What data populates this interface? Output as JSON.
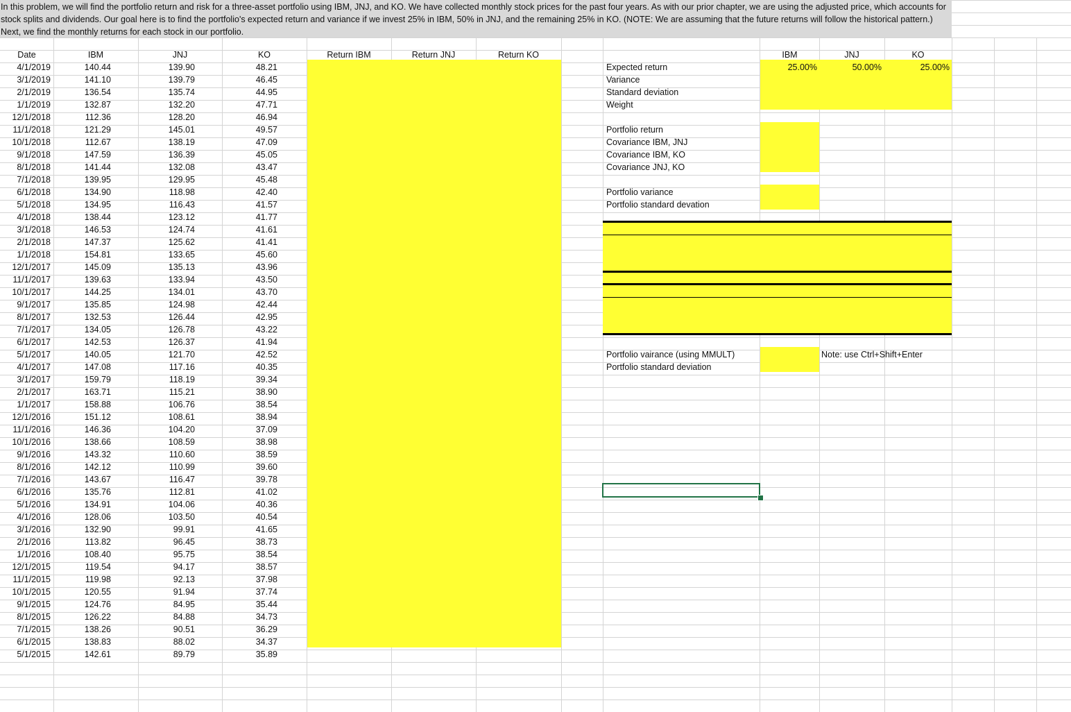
{
  "intro": {
    "text": "In this problem, we will find the portfolio return and risk for a three-asset portfolio using IBM, JNJ, and KO. We have collected monthly stock prices for the past four years. As with our prior chapter, we are using the adjusted price, which accounts for stock splits and dividends. Our goal here is to find the portfolio's expected return and variance if we invest 25% in IBM, 50% in JNJ, and the remaining 25% in KO. (NOTE: We are assuming that the future returns will follow the historical pattern.) Next, we find the monthly returns for each stock in our portfolio."
  },
  "headers": {
    "date": "Date",
    "ibm": "IBM",
    "jnj": "JNJ",
    "ko": "KO",
    "ret_ibm": "Return IBM",
    "ret_jnj": "Return JNJ",
    "ret_ko": "Return KO"
  },
  "rows": [
    [
      "4/1/2019",
      "140.44",
      "139.90",
      "48.21"
    ],
    [
      "3/1/2019",
      "141.10",
      "139.79",
      "46.45"
    ],
    [
      "2/1/2019",
      "136.54",
      "135.74",
      "44.95"
    ],
    [
      "1/1/2019",
      "132.87",
      "132.20",
      "47.71"
    ],
    [
      "12/1/2018",
      "112.36",
      "128.20",
      "46.94"
    ],
    [
      "11/1/2018",
      "121.29",
      "145.01",
      "49.57"
    ],
    [
      "10/1/2018",
      "112.67",
      "138.19",
      "47.09"
    ],
    [
      "9/1/2018",
      "147.59",
      "136.39",
      "45.05"
    ],
    [
      "8/1/2018",
      "141.44",
      "132.08",
      "43.47"
    ],
    [
      "7/1/2018",
      "139.95",
      "129.95",
      "45.48"
    ],
    [
      "6/1/2018",
      "134.90",
      "118.98",
      "42.40"
    ],
    [
      "5/1/2018",
      "134.95",
      "116.43",
      "41.57"
    ],
    [
      "4/1/2018",
      "138.44",
      "123.12",
      "41.77"
    ],
    [
      "3/1/2018",
      "146.53",
      "124.74",
      "41.61"
    ],
    [
      "2/1/2018",
      "147.37",
      "125.62",
      "41.41"
    ],
    [
      "1/1/2018",
      "154.81",
      "133.65",
      "45.60"
    ],
    [
      "12/1/2017",
      "145.09",
      "135.13",
      "43.96"
    ],
    [
      "11/1/2017",
      "139.63",
      "133.94",
      "43.50"
    ],
    [
      "10/1/2017",
      "144.25",
      "134.01",
      "43.70"
    ],
    [
      "9/1/2017",
      "135.85",
      "124.98",
      "42.44"
    ],
    [
      "8/1/2017",
      "132.53",
      "126.44",
      "42.95"
    ],
    [
      "7/1/2017",
      "134.05",
      "126.78",
      "43.22"
    ],
    [
      "6/1/2017",
      "142.53",
      "126.37",
      "41.94"
    ],
    [
      "5/1/2017",
      "140.05",
      "121.70",
      "42.52"
    ],
    [
      "4/1/2017",
      "147.08",
      "117.16",
      "40.35"
    ],
    [
      "3/1/2017",
      "159.79",
      "118.19",
      "39.34"
    ],
    [
      "2/1/2017",
      "163.71",
      "115.21",
      "38.90"
    ],
    [
      "1/1/2017",
      "158.88",
      "106.76",
      "38.54"
    ],
    [
      "12/1/2016",
      "151.12",
      "108.61",
      "38.94"
    ],
    [
      "11/1/2016",
      "146.36",
      "104.20",
      "37.09"
    ],
    [
      "10/1/2016",
      "138.66",
      "108.59",
      "38.98"
    ],
    [
      "9/1/2016",
      "143.32",
      "110.60",
      "38.59"
    ],
    [
      "8/1/2016",
      "142.12",
      "110.99",
      "39.60"
    ],
    [
      "7/1/2016",
      "143.67",
      "116.47",
      "39.78"
    ],
    [
      "6/1/2016",
      "135.76",
      "112.81",
      "41.02"
    ],
    [
      "5/1/2016",
      "134.91",
      "104.06",
      "40.36"
    ],
    [
      "4/1/2016",
      "128.06",
      "103.50",
      "40.54"
    ],
    [
      "3/1/2016",
      "132.90",
      "99.91",
      "41.65"
    ],
    [
      "2/1/2016",
      "113.82",
      "96.45",
      "38.73"
    ],
    [
      "1/1/2016",
      "108.40",
      "95.75",
      "38.54"
    ],
    [
      "12/1/2015",
      "119.54",
      "94.17",
      "38.57"
    ],
    [
      "11/1/2015",
      "119.98",
      "92.13",
      "37.98"
    ],
    [
      "10/1/2015",
      "120.55",
      "91.94",
      "37.74"
    ],
    [
      "9/1/2015",
      "124.76",
      "84.95",
      "35.44"
    ],
    [
      "8/1/2015",
      "126.22",
      "84.88",
      "34.73"
    ],
    [
      "7/1/2015",
      "138.26",
      "90.51",
      "36.29"
    ],
    [
      "6/1/2015",
      "138.83",
      "88.02",
      "34.37"
    ],
    [
      "5/1/2015",
      "142.61",
      "89.79",
      "35.89"
    ]
  ],
  "summary": {
    "col_ibm": "IBM",
    "col_jnj": "JNJ",
    "col_ko": "KO",
    "weights": {
      "ibm": "25.00%",
      "jnj": "50.00%",
      "ko": "25.00%"
    },
    "labels": {
      "expected_return": "Expected return",
      "variance": "Variance",
      "std_dev": "Standard deviation",
      "weight": "Weight",
      "portfolio_return": "Portfolio return",
      "cov_ibm_jnj": "Covariance IBM, JNJ",
      "cov_ibm_ko": "Covariance IBM, KO",
      "cov_jnj_ko": "Covariance JNJ, KO",
      "portfolio_variance": "Portfolio variance",
      "portfolio_std": "Portfolio standard devation",
      "portfolio_var_mmult": "Portfolio vairance (using MMULT)",
      "portfolio_std2": "Portfolio standard deviation"
    },
    "note": "Note: use Ctrl+Shift+Enter"
  },
  "colors": {
    "highlight": "#ffff33",
    "selection": "#217346",
    "intro_bg": "#d9d9d9"
  }
}
